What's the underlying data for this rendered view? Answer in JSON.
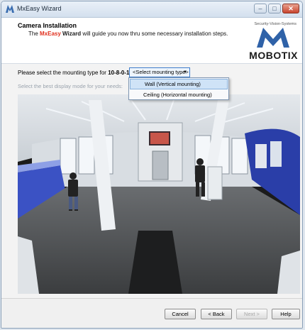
{
  "window": {
    "title": "MxEasy Wizard"
  },
  "header": {
    "title": "Camera Installation",
    "subtitle_pre": "The ",
    "subtitle_brand_a": "MxEasy",
    "subtitle_brand_b": " Wizard",
    "subtitle_post": " will guide you now thru some necessary installation steps.",
    "logo_tagline": "Security-Vision-Systems",
    "logo_wordmark": "MOBOTIX"
  },
  "mounting": {
    "prompt": "Please select the mounting type for ",
    "camera_id": "10-8-0-118:",
    "select_value": "<Select mounting type>",
    "options": [
      "Wall (Vertical mounting)",
      "Ceiling (Horizontal mounting)"
    ],
    "highlighted_index": 0,
    "display_hint": "Select the best display mode for your needs:"
  },
  "footer": {
    "cancel": "Cancel",
    "back": "< Back",
    "next": "Next >",
    "help": "Help"
  },
  "colors": {
    "accent_red": "#e0301e",
    "select_border": "#3e7dcc"
  },
  "icons": [
    "mobotix-logo-icon",
    "minimize-icon",
    "maximize-icon",
    "close-icon",
    "dropdown-caret-icon"
  ]
}
